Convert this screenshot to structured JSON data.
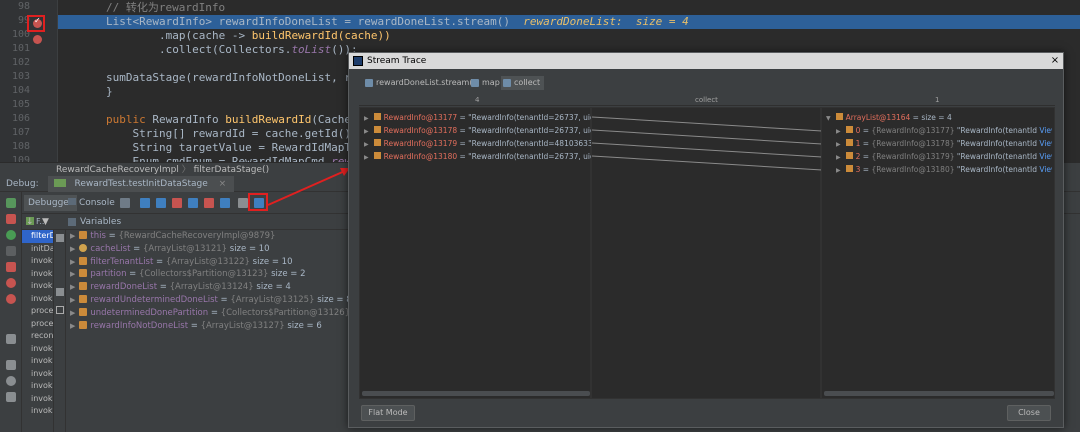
{
  "editor": {
    "line_numbers": [
      "98",
      "99",
      "100",
      "101",
      "102",
      "103",
      "104",
      "105",
      "106",
      "107",
      "108",
      "109"
    ],
    "lines": [
      {
        "tokens": [
          {
            "t": "// 转化为rewardInfo",
            "c": "cm"
          }
        ]
      },
      {
        "tokens": [
          {
            "t": "List<RewardInfo> rewardInfoDoneList = rewardDoneList.stream()  ",
            "c": ""
          },
          {
            "t": "rewardDoneList:  size = 4",
            "c": "inl"
          }
        ]
      },
      {
        "tokens": [
          {
            "t": "        .map(cache -> ",
            "c": ""
          },
          {
            "t": "buildRewardId(cache))",
            "c": "fn"
          }
        ]
      },
      {
        "tokens": [
          {
            "t": "        .collect(Collectors.",
            "c": ""
          },
          {
            "t": "toList",
            "c": "it"
          },
          {
            "t": "());",
            "c": ""
          }
        ]
      },
      {
        "tokens": [
          {
            "t": "",
            "c": ""
          }
        ]
      },
      {
        "tokens": [
          {
            "t": "sumDataStage(rewardInfoNotDoneList, rewa",
            "c": ""
          }
        ]
      },
      {
        "tokens": [
          {
            "t": "}",
            "c": ""
          }
        ]
      },
      {
        "tokens": [
          {
            "t": "",
            "c": ""
          }
        ]
      },
      {
        "tokens": [
          {
            "t": "public ",
            "c": "kw"
          },
          {
            "t": "RewardInfo ",
            "c": ""
          },
          {
            "t": "buildRewardId",
            "c": "fn"
          },
          {
            "t": "(Cache cache,",
            "c": ""
          }
        ]
      },
      {
        "tokens": [
          {
            "t": "    String[] rewardId = cache.getId().replac",
            "c": ""
          }
        ]
      },
      {
        "tokens": [
          {
            "t": "    String targetValue = RewardIdMapTargetVa",
            "c": ""
          }
        ]
      },
      {
        "tokens": [
          {
            "t": "    Enum cmdEnum = RewardIdMapCmd.",
            "c": ""
          },
          {
            "t": "rewardIdCm",
            "c": "it"
          }
        ]
      }
    ],
    "breadcrumb": [
      "RewardCacheRecoveryImpl",
      "filterDataStage()"
    ]
  },
  "debug": {
    "tabs": [
      "Debug:",
      "RewardTest.testInitDataStage",
      "×"
    ],
    "subtabs": [
      "Debugger",
      "Console",
      "Variables"
    ],
    "frames_label": "F...",
    "frames": [
      "filterD",
      "initDa",
      "invok",
      "invok",
      "invok",
      "invok",
      "proce",
      "proce",
      "recon",
      "invok",
      "invok",
      "invok",
      "invok",
      "invok",
      "invok"
    ],
    "variables": [
      {
        "name": "this",
        "type": "{RewardCacheRecoveryImpl@9879}",
        "size": "",
        "kind": "field"
      },
      {
        "name": "cacheList",
        "type": "{ArrayList@13121}",
        "size": "size = 10",
        "kind": "param"
      },
      {
        "name": "filterTenantList",
        "type": "{ArrayList@13122}",
        "size": "size = 10",
        "kind": "field"
      },
      {
        "name": "partition",
        "type": "{Collectors$Partition@13123}",
        "size": "size = 2",
        "kind": "field"
      },
      {
        "name": "rewardDoneList",
        "type": "{ArrayList@13124}",
        "size": "size = 4",
        "kind": "field"
      },
      {
        "name": "rewardUndeterminedDoneList",
        "type": "{ArrayList@13125}",
        "size": "size = 8",
        "kind": "field"
      },
      {
        "name": "undeterminedDonePartition",
        "type": "{Collectors$Partition@13126}",
        "size": "size = 2",
        "kind": "field"
      },
      {
        "name": "rewardInfoNotDoneList",
        "type": "{ArrayList@13127}",
        "size": "size = 6",
        "kind": "field"
      }
    ]
  },
  "dialog": {
    "title": "Stream Trace",
    "close_glyph": "×",
    "tabs": [
      "rewardDoneList.stream()",
      "map",
      "collect"
    ],
    "col_left": "4",
    "col_mid": "collect",
    "col_right": "1",
    "left_rows": [
      {
        "name": "RewardInfo@13177",
        "value": "\"RewardInfo(tenantId=26737, uid=;"
      },
      {
        "name": "RewardInfo@13178",
        "value": "\"RewardInfo(tenantId=26737, uid=;"
      },
      {
        "name": "RewardInfo@13179",
        "value": "\"RewardInfo(tenantId=4810363371!"
      },
      {
        "name": "RewardInfo@13180",
        "value": "\"RewardInfo(tenantId=26737, uid=;"
      }
    ],
    "right_header": {
      "name": "ArrayList@13164",
      "size": "size = 4"
    },
    "right_rows": [
      {
        "idx": "0",
        "type": "{RewardInfo@13177}",
        "value": "\"RewardInfo(tenantId",
        "link": "View"
      },
      {
        "idx": "1",
        "type": "{RewardInfo@13178}",
        "value": "\"RewardInfo(tenantId",
        "link": "View"
      },
      {
        "idx": "2",
        "type": "{RewardInfo@13179}",
        "value": "\"RewardInfo(tenantId",
        "link": "View"
      },
      {
        "idx": "3",
        "type": "{RewardInfo@13180}",
        "value": "\"RewardInfo(tenantId",
        "link": "View"
      }
    ],
    "flat_mode": "Flat Mode",
    "close": "Close"
  },
  "colors": {
    "highlight": "#2d6099",
    "annotation": "#e02020",
    "breakpoint": "#c75450"
  }
}
